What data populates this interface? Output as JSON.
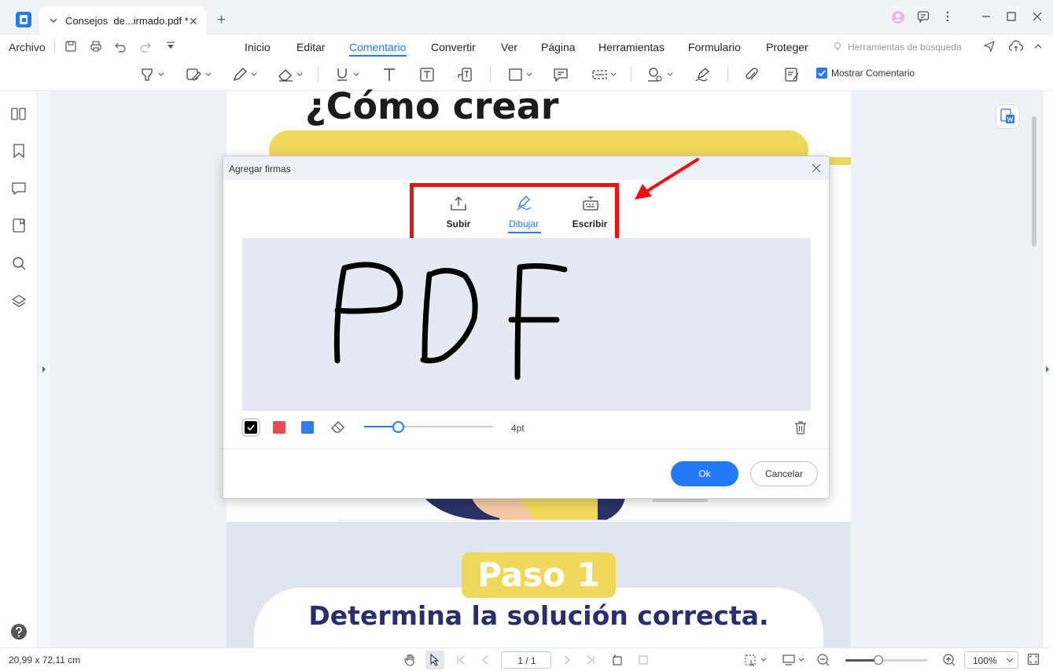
{
  "tab": {
    "title": "Consejos  de...irmado.pdf *"
  },
  "menu": {
    "archivo": "Archivo",
    "items": [
      "Inicio",
      "Editar",
      "Comentario",
      "Convertir",
      "Ver",
      "Página",
      "Herramientas",
      "Formulario",
      "Proteger"
    ],
    "active": "Comentario",
    "search_tools": "Herramientas de búsqueda"
  },
  "toolbar": {
    "show_comment_label": "Mostrar Comentario",
    "show_comment_checked": true
  },
  "document": {
    "heading": "¿Cómo crear",
    "step_badge": "Paso 1",
    "step_title": "Determina la solución correcta."
  },
  "dialog": {
    "title": "Agregar firmas",
    "modes": [
      {
        "label": "Subir",
        "icon": "upload-icon"
      },
      {
        "label": "Dibujar",
        "icon": "pen-draw-icon"
      },
      {
        "label": "Escribir",
        "icon": "keyboard-icon"
      }
    ],
    "active_mode": "Dibujar",
    "signature_strokes": "PDF",
    "colors": [
      "#000000",
      "#e84d4a",
      "#2e7cf0"
    ],
    "selected_color": "#000000",
    "thickness": "4pt",
    "thickness_fraction": 0.27,
    "ok_label": "Ok",
    "cancel_label": "Cancelar"
  },
  "status": {
    "dimensions": "20,99 x 72,11 cm",
    "page_counter": "1 / 1",
    "zoom": "100%",
    "zoom_fraction": 0.4
  },
  "colors": {
    "accent": "#2479f7",
    "annotation_red": "#ee1111",
    "banner_yellow": "#efd85c"
  }
}
